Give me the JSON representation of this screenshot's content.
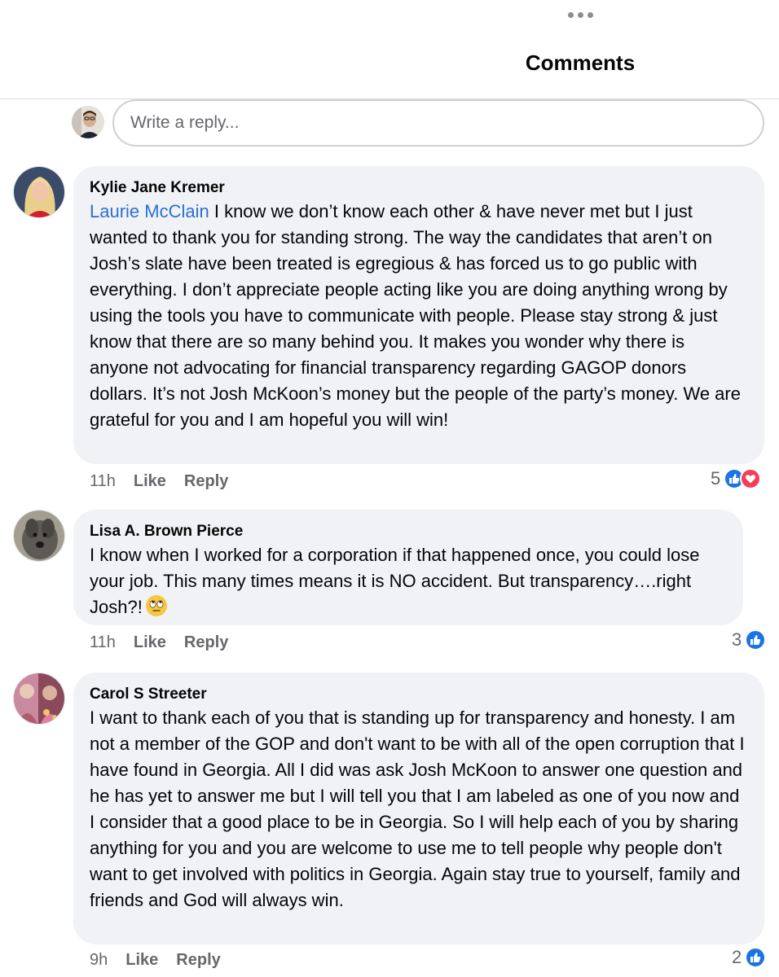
{
  "header": {
    "title": "Comments"
  },
  "reply_box": {
    "placeholder": "Write a reply..."
  },
  "comments": [
    {
      "author": "Kylie Jane Kremer",
      "mention": "Laurie McClain",
      "text": " I know we don’t know each other & have never met but I just wanted to thank you for standing strong. The way the candidates that aren’t on Josh’s slate have been treated is egregious & has forced us to go public with everything. I don’t appreciate people acting like you are doing anything wrong by using the tools you have to communicate with people. Please stay strong & just know that there are so many behind you. It makes you wonder why there is anyone not advocating for financial transparency regarding GAGOP donors dollars. It’s not Josh McKoon’s money but the people of the party’s money. We are grateful for you and I am hopeful you will win!",
      "time": "11h",
      "like_label": "Like",
      "reply_label": "Reply",
      "reaction_count": "5",
      "reaction_icons": [
        "like-icon",
        "love-icon"
      ]
    },
    {
      "author": "Lisa A. Brown Pierce",
      "text": "I know when I worked for a corporation if that happened once, you could lose your job.  This many times means it is NO accident. But transparency….right Josh?!",
      "emoji": "eye-roll-emoji",
      "time": "11h",
      "like_label": "Like",
      "reply_label": "Reply",
      "reaction_count": "3",
      "reaction_icons": [
        "like-icon"
      ]
    },
    {
      "author": "Carol S Streeter",
      "text": "I want to thank each of you that is standing up for transparency and honesty. I am not a member of the GOP and don't want to be with all of the open corruption that I have found in Georgia.  All I did was ask Josh McKoon to answer one question and he has yet to answer me but I will tell you that I am labeled as one of you now and I consider that a good place to be in Georgia. So I will help each of you by sharing anything for you and you are welcome to use me to tell people why people don't want to get involved with politics in Georgia. Again stay true to yourself, family and friends and God will always win.",
      "time": "9h",
      "like_label": "Like",
      "reply_label": "Reply",
      "reaction_count": "2",
      "reaction_icons": [
        "like-icon"
      ]
    }
  ],
  "colors": {
    "mention": "#2d6fd6",
    "bubble": "#f0f2f5",
    "meta_text": "#65676b",
    "like_blue": "#1b74e4",
    "love_red": "#f33e58"
  }
}
